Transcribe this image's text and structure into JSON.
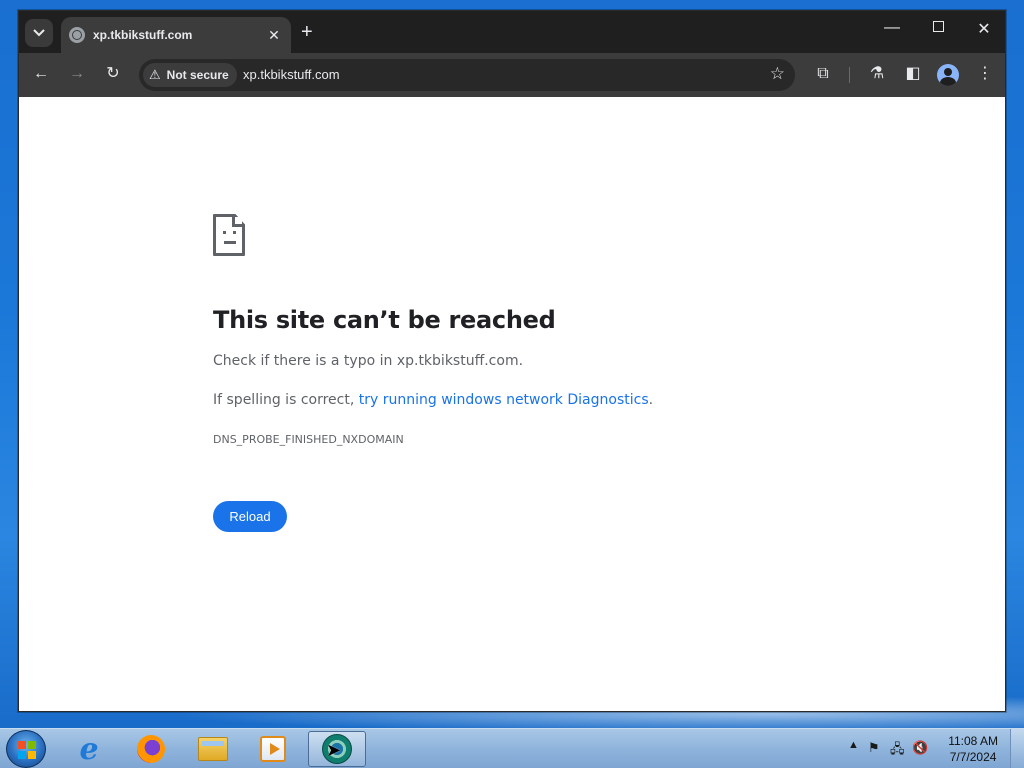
{
  "browser": {
    "tab": {
      "title": "xp.tkbikstuff.com",
      "close_glyph": "✕",
      "favicon": "globe-icon"
    },
    "new_tab_glyph": "+",
    "window_controls": {
      "minimize": "—",
      "close": "✕"
    },
    "toolbar": {
      "back": "←",
      "forward": "→",
      "reload": "↻",
      "security_label": "Not secure",
      "security_icon": "⚠",
      "url": "xp.tkbikstuff.com",
      "bookmark": "☆",
      "extensions": "⧉",
      "labs": "⚗",
      "side_panel": "◧",
      "menu": "⋮"
    }
  },
  "error_page": {
    "title": "This site can’t be reached",
    "line1": "Check if there is a typo in xp.tkbikstuff.com.",
    "line2_prefix": "If spelling is correct, ",
    "line2_link": "try running windows network Diagnostics",
    "line2_suffix": ".",
    "error_code": "DNS_PROBE_FINISHED_NXDOMAIN",
    "reload_label": "Reload"
  },
  "taskbar": {
    "apps": [
      "internet-explorer",
      "firefox",
      "file-explorer",
      "media-player",
      "browser-active"
    ],
    "tray": {
      "overflow": "▲",
      "flag": "⚑",
      "network": "🖧",
      "volume": "🔇"
    },
    "clock": {
      "time": "11:08 AM",
      "date": "7/7/2024"
    }
  },
  "colors": {
    "accent": "#1a73e8",
    "tab_bg": "#3c3c3c",
    "chrome_bg": "#1f1f1f",
    "taskbar": "#8fb4dc"
  }
}
